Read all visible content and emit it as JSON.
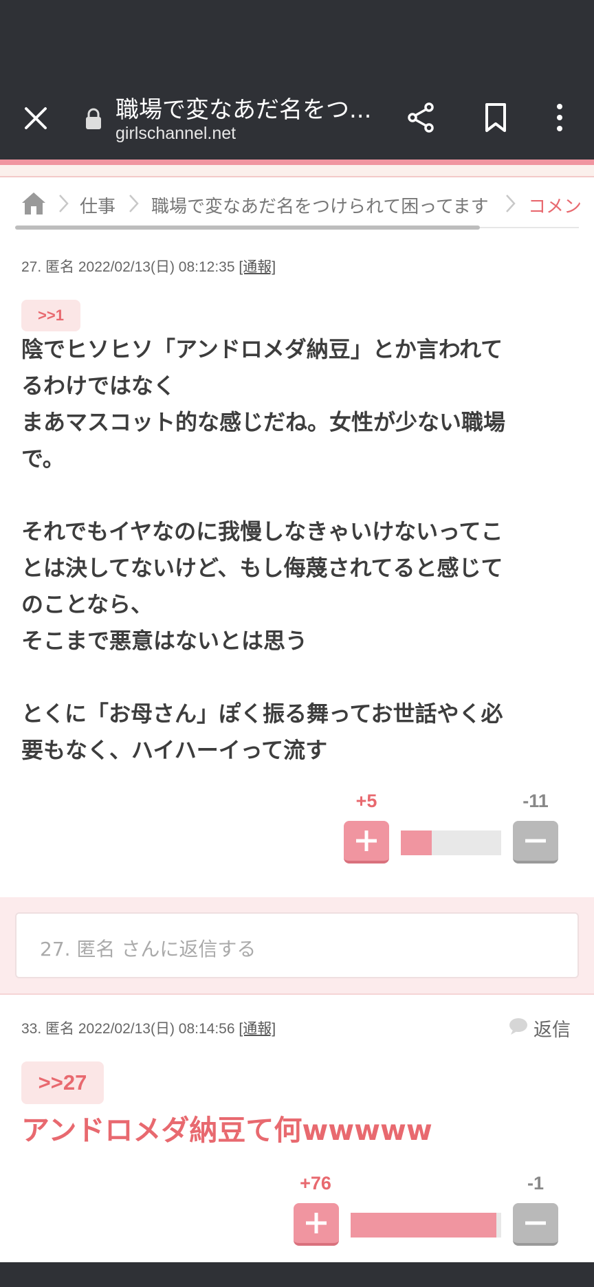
{
  "browser": {
    "title": "職場で変なあだ名をつ...",
    "url": "girlschannel.net"
  },
  "breadcrumb": {
    "items": [
      "仕事",
      "職場で変なあだ名をつけられて困ってます",
      "コメン"
    ]
  },
  "comments": [
    {
      "meta": "27. 匿名 2022/02/13(日) 08:12:35",
      "report_label": "[通報]",
      "anchor": ">>1",
      "body": "陰でヒソヒソ「アンドロメダ納豆」とか言われて\nるわけではなく\nまあマスコット的な感じだね。女性が少ない職場\nで。\n\nそれでもイヤなのに我慢しなきゃいけないってこ\nとは決してないけど、もし侮蔑されてると感じて\nのことなら、\nそこまで悪意はないとは思う\n\nとくに「お母さん」ぽく振る舞ってお世話やく必\n要もなく、ハイハーイって流す",
      "plus": "+5",
      "minus": "-11",
      "plus_ratio": 0.31
    },
    {
      "meta": "33. 匿名 2022/02/13(日) 08:14:56",
      "report_label": "[通報]",
      "anchor": ">>27",
      "body": "アンドロメダ納豆て何wwwww",
      "plus": "+76",
      "minus": "-1",
      "plus_ratio": 0.97
    }
  ],
  "reply_box": {
    "placeholder": "27. 匿名 さんに返信する"
  },
  "reply_link": "返信",
  "colors": {
    "accent": "#e8696f",
    "bar": "#2f3136"
  }
}
